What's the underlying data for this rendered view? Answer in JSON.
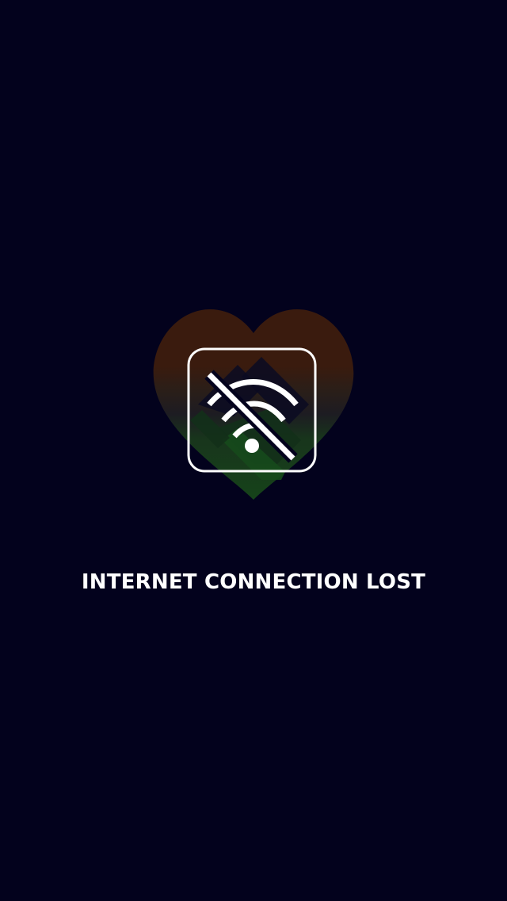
{
  "screen": {
    "background": "#03021d"
  },
  "logo": {
    "icon": "heart-handshake-logo-icon",
    "colors": {
      "top": "#3a1b0e",
      "middle": "#1e1a18",
      "bottom": "#16431a"
    }
  },
  "offline_icon": {
    "icon": "wifi-off-icon",
    "color": "#ffffff"
  },
  "message": {
    "text": "INTERNET CONNECTION LOST"
  }
}
